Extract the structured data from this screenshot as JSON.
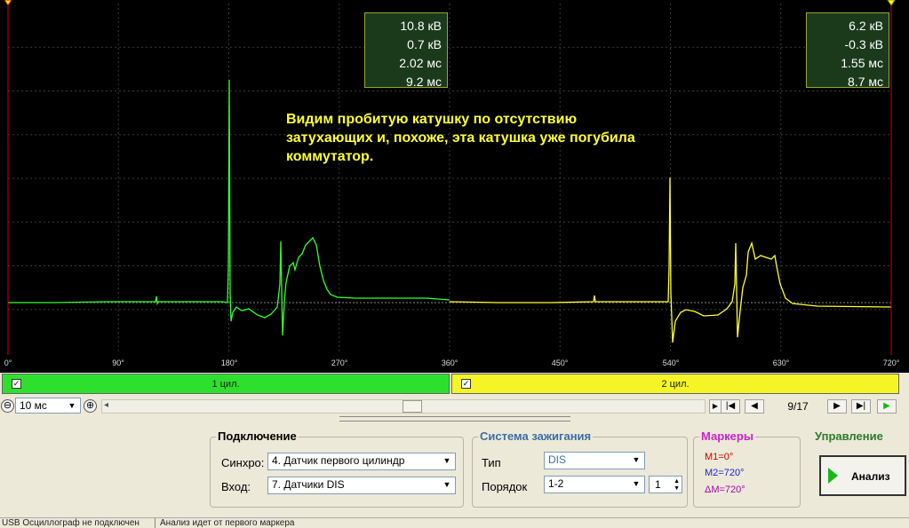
{
  "measurements": {
    "left": [
      "10.8 кВ",
      "0.7 кВ",
      "2.02 мс",
      "9.2 мс"
    ],
    "right": [
      "6.2 кВ",
      "-0.3 кВ",
      "1.55 мс",
      "8.7 мс"
    ]
  },
  "note": "Видим пробитую катушку по отсутствию затухающих и, похоже, эта катушка уже погубила коммутатор.",
  "axis_ticks": [
    "0°",
    "90°",
    "180°",
    "270°",
    "360°",
    "450°",
    "540°",
    "630°",
    "720°"
  ],
  "cylinders": [
    {
      "label": "1 цил.",
      "color": "#2ee02e",
      "checkmark": "✓"
    },
    {
      "label": "2 цил.",
      "color": "#f5f526",
      "checkmark": "✓"
    }
  ],
  "colors": {
    "trace_cyl1": "#33ff33",
    "trace_cyl2": "#ffff33",
    "marker_line": "#cc0000",
    "marker_diamond": "#ffff00",
    "grid": "#3a3a3a",
    "baseline": "#888888"
  },
  "nav": {
    "zoom_out": "⊖",
    "timebase": "10 мс",
    "zoom_in": "⊕",
    "scroll_left": "◂",
    "page": "9/17",
    "first": "|◀",
    "prev": "◀",
    "next": "▶",
    "last": "▶|",
    "play": "▶"
  },
  "connection": {
    "title": "Подключение",
    "sync_label": "Синхро:",
    "sync_value": "4.  Датчик первого цилиндр",
    "input_label": "Вход:",
    "input_value": "7.  Датчики DIS"
  },
  "ignition": {
    "title": "Система зажигания",
    "type_label": "Тип",
    "type_value": "DIS",
    "order_label": "Порядок",
    "order_value": "1-2",
    "order_spin": "1"
  },
  "markers": {
    "title": "Маркеры",
    "m1": "M1=0°",
    "m2": "M2=720°",
    "dm": "ΔM=720°"
  },
  "control": {
    "title": "Управление",
    "analyze_label": "Анализ"
  },
  "status": {
    "left": "USB Осциллограф не подключен",
    "right": "Анализ идет от первого маркера"
  },
  "icons": {
    "dropdown": "chevron-down-icon",
    "play": "play-icon"
  }
}
